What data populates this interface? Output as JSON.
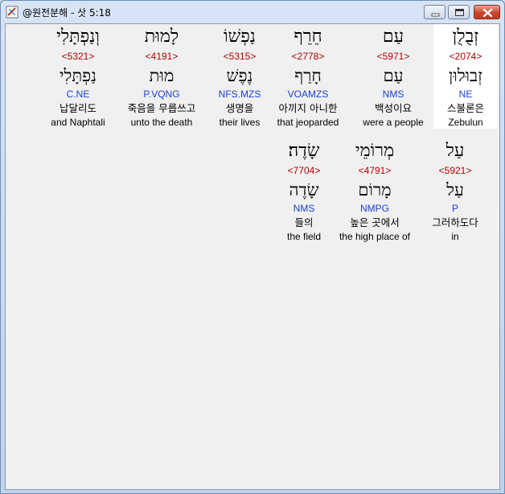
{
  "window": {
    "title": "@원전분해 - 삿 5:18"
  },
  "words": [
    {
      "hebrew": "זְבֻלֻן",
      "strong": "<2074>",
      "lemma": "זְבוּלוּן",
      "morph": "NE",
      "korean": "스불론은",
      "english": "Zebulun",
      "highlighted": true
    },
    {
      "hebrew": "עַם",
      "strong": "<5971>",
      "lemma": "עַם",
      "morph": "NMS",
      "korean": "백성이요",
      "english": "were a people",
      "highlighted": false
    },
    {
      "hebrew": "חֵרֵף",
      "strong": "<2778>",
      "lemma": "חָרַף",
      "morph": "VOAMZS",
      "korean": "아끼지 아니한",
      "english": "that jeoparded",
      "highlighted": false
    },
    {
      "hebrew": "נַפְשׁוֹ",
      "strong": "<5315>",
      "lemma": "נֶפֶשׁ",
      "morph": "NFS.MZS",
      "korean": "생명을",
      "english": "their lives",
      "highlighted": false
    },
    {
      "hebrew": "לָמוּת",
      "strong": "<4191>",
      "lemma": "מוּת",
      "morph": "P.VQNG",
      "korean": "죽음을 무릅쓰고",
      "english": "unto the death",
      "highlighted": false
    },
    {
      "hebrew": "וְנַפְתָּלִי",
      "strong": "<5321>",
      "lemma": "נַפְתָּלִי",
      "morph": "C.NE",
      "korean": "납달리도",
      "english": "and Naphtali",
      "highlighted": false
    },
    {
      "hebrew": "עַל",
      "strong": "<5921>",
      "lemma": "עַל",
      "morph": "P",
      "korean": "그러하도다",
      "english": "in",
      "highlighted": false
    },
    {
      "hebrew": "מְרוֹמֵי",
      "strong": "<4791>",
      "lemma": "מָרוֹם",
      "morph": "NMPG",
      "korean": "높은 곳에서",
      "english": "the high place of",
      "highlighted": false
    },
    {
      "hebrew": "שָׂדֶה׃",
      "strong": "<7704>",
      "lemma": "שָׂדֶה",
      "morph": "NMS",
      "korean": "들의",
      "english": "the field",
      "highlighted": false
    }
  ]
}
